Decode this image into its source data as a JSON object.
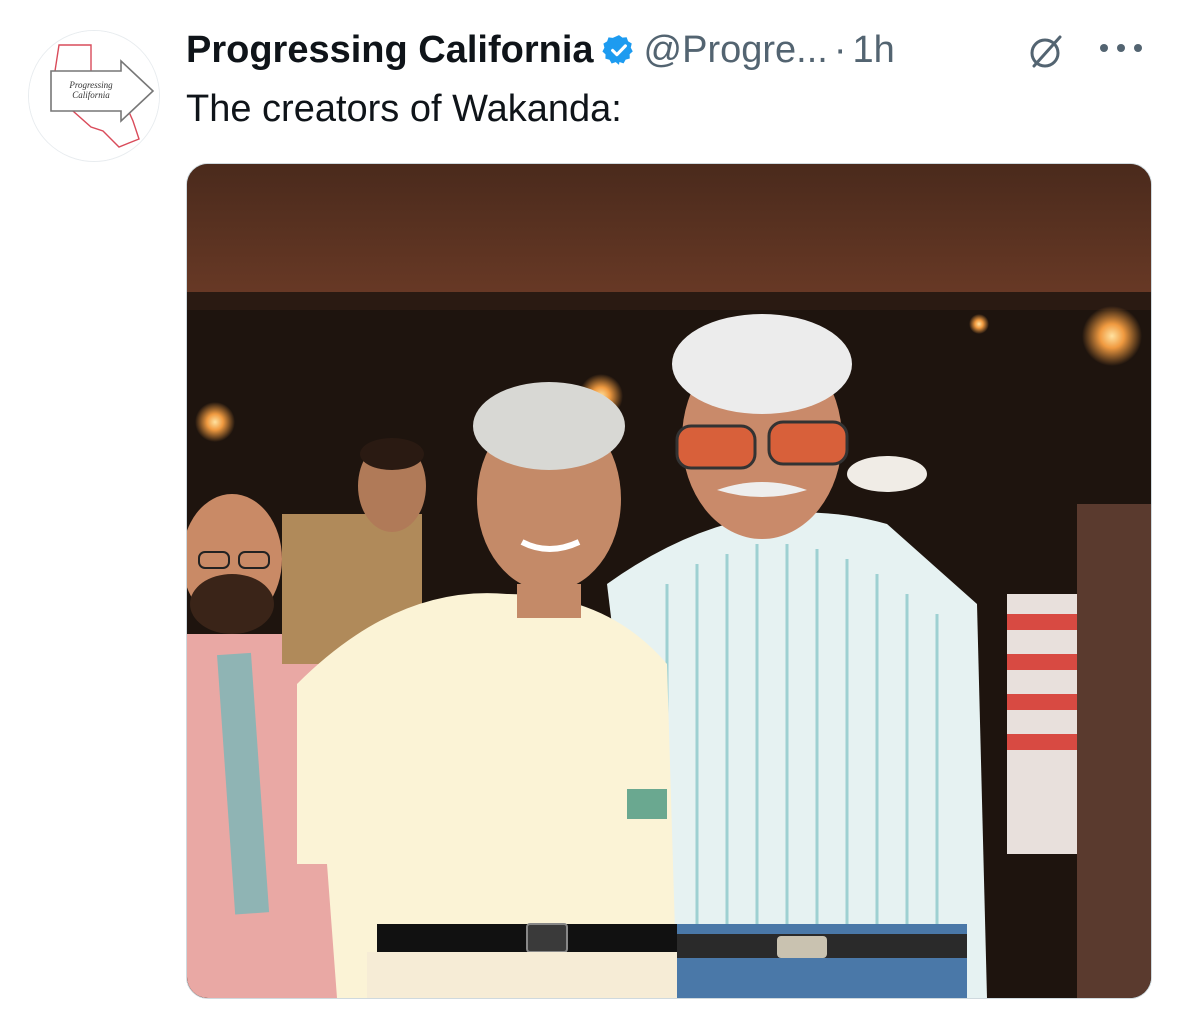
{
  "account": {
    "display_name": "Progressing California",
    "handle": "@Progre...",
    "separator": "·",
    "time": "1h",
    "verified": true,
    "avatar_text_line1": "Progressing",
    "avatar_text_line2": "California"
  },
  "tweet": {
    "text": "The creators of Wakanda:"
  },
  "icons": {
    "verified": "verified-badge-icon",
    "grok": "grok-icon",
    "more": "more-options-icon"
  },
  "colors": {
    "verified": "#1d9bf0",
    "text_primary": "#0f1419",
    "text_secondary": "#536471"
  }
}
